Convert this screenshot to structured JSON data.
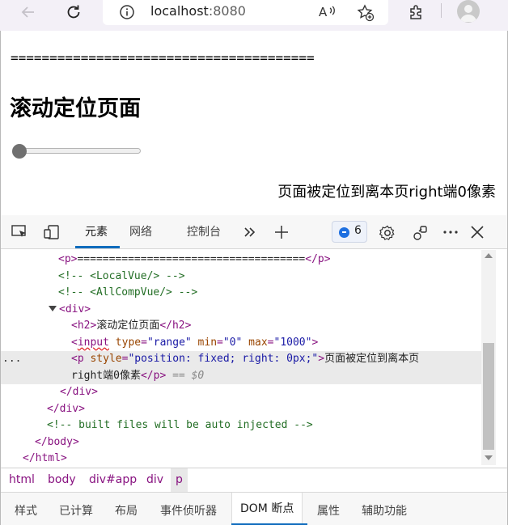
{
  "browser": {
    "url_host": "localhost",
    "url_port": ":8080"
  },
  "page": {
    "separator": "=======================================",
    "heading": "滚动定位页面",
    "range": {
      "min": 0,
      "max": 1000,
      "value": 0
    },
    "fixed_text": "页面被定位到离本页right端0像素"
  },
  "devtools": {
    "tabs": {
      "elements": "元素",
      "network": "网络",
      "console": "控制台"
    },
    "badge_count": "6",
    "code": {
      "l1_open": "<p>",
      "l1_text": "====================================",
      "l1_close": "</p>",
      "l2": "<!-- <LocalVue/> -->",
      "l3": "<!-- <AllCompVue/> -->",
      "l4": "<div>",
      "l5_open": "<h2>",
      "l5_text": "滚动定位页面",
      "l5_close": "</h2>",
      "l6_lt": "<",
      "l6_tag": "input",
      "l6_a1": " type",
      "l6_v1": "\"range\"",
      "l6_a2": " min",
      "l6_v2": "\"0\"",
      "l6_a3": " max",
      "l6_v3": "\"1000\"",
      "l6_gt": ">",
      "l7_lt": "<p",
      "l7_a1": " style",
      "l7_v1": "\"position: fixed; right: 0px;\"",
      "l7_gt": ">",
      "l7_text": "页面被定位到离本页",
      "l8_text": "right端0像素",
      "l8_close": "</p>",
      "l8_eq": "== $0",
      "l9": "</div>",
      "l10": "</div>",
      "l11": "<!-- built files will be auto injected -->",
      "l12": "</body>",
      "l13": "</html>",
      "ellipsis": "..."
    },
    "breadcrumb": [
      "html",
      "body",
      "div#app",
      "div",
      "p"
    ],
    "bottom_tabs": {
      "styles": "样式",
      "computed": "已计算",
      "layout": "布局",
      "listeners": "事件侦听器",
      "dom_breakpoints": "DOM 断点",
      "properties": "属性",
      "accessibility": "辅助功能"
    }
  }
}
